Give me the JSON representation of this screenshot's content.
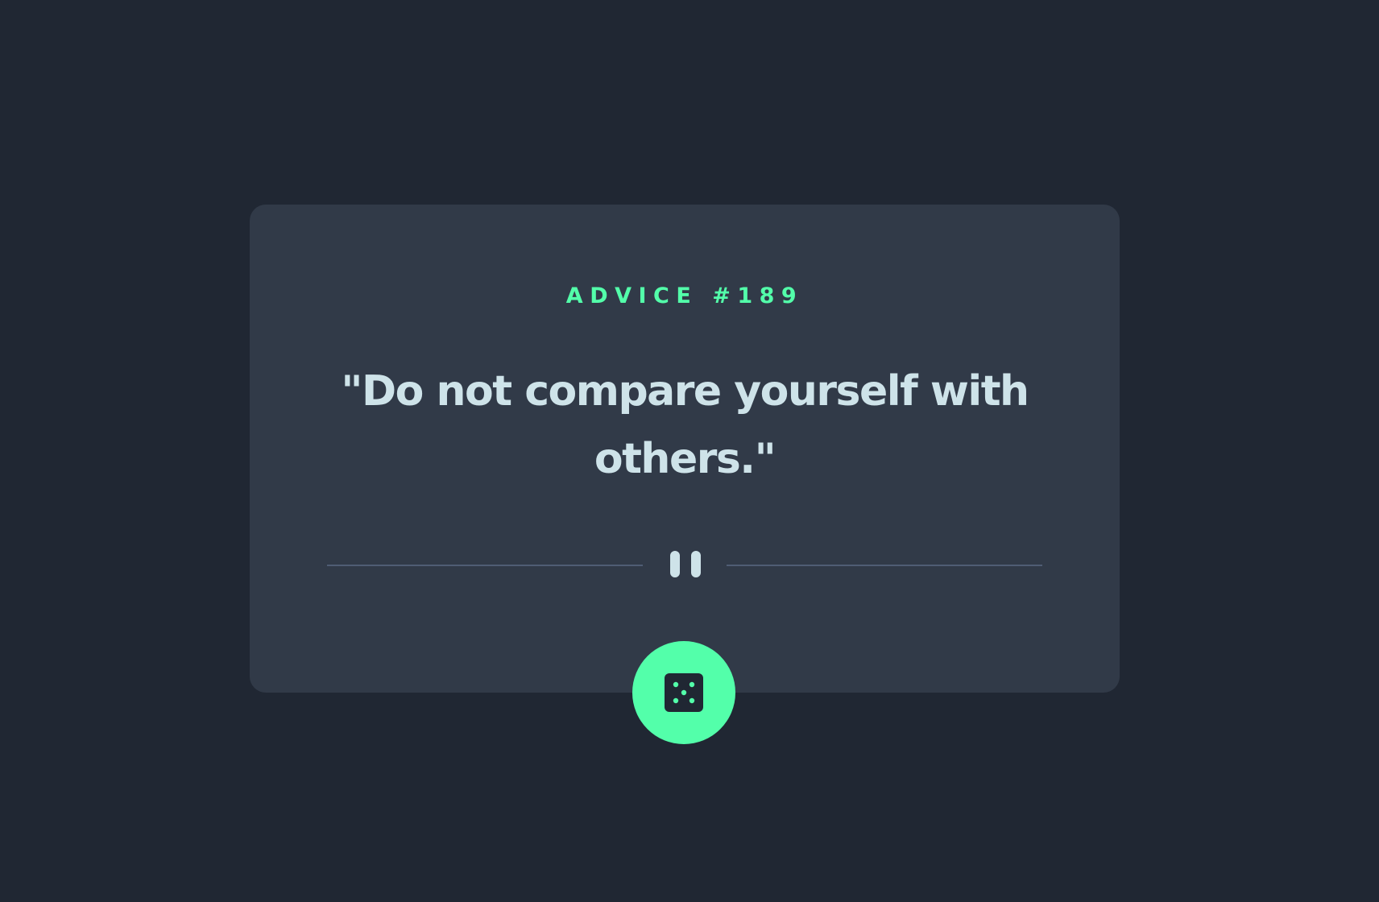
{
  "card": {
    "advice_label": "ADVICE #189",
    "quote": "\"Do not compare yourself with others.\""
  },
  "divider": {
    "icon": "pause-icon"
  },
  "actions": {
    "generate_icon": "dice-icon"
  },
  "colors": {
    "background": "#202733",
    "card": "#313A48",
    "accent": "#53FFAA",
    "text": "#CEE3E9",
    "divider": "#4F5D74"
  }
}
